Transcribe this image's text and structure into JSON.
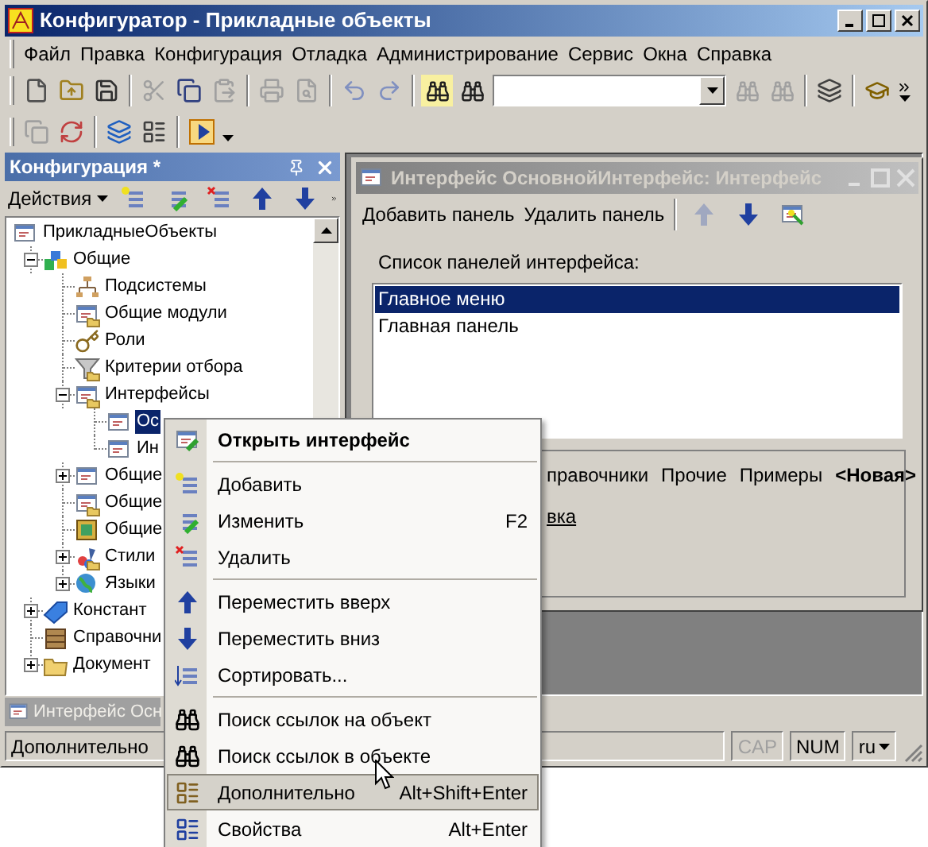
{
  "window": {
    "title": "Конфигуратор - Прикладные объекты"
  },
  "menu_bar": [
    "Файл",
    "Правка",
    "Конфигурация",
    "Отладка",
    "Администрирование",
    "Сервис",
    "Окна",
    "Справка"
  ],
  "config_panel": {
    "title": "Конфигурация *",
    "actions_label": "Действия",
    "tree": [
      {
        "label": "ПрикладныеОбъекты",
        "selected": false,
        "children": [
          {
            "label": "Общие",
            "selected": false,
            "expanded": true,
            "children": [
              {
                "label": "Подсистемы",
                "selected": false
              },
              {
                "label": "Общие модули",
                "selected": false
              },
              {
                "label": "Роли",
                "selected": false
              },
              {
                "label": "Критерии отбора",
                "selected": false
              },
              {
                "label": "Интерфейсы",
                "selected": false,
                "expanded": true,
                "children": [
                  {
                    "label": "Ос",
                    "selected": true
                  },
                  {
                    "label": "Ин",
                    "selected": false
                  }
                ]
              },
              {
                "label": "Общие",
                "selected": false,
                "expanded": false
              },
              {
                "label": "Общие",
                "selected": false
              },
              {
                "label": "Общие",
                "selected": false
              },
              {
                "label": "Стили",
                "selected": false,
                "expanded": false
              },
              {
                "label": "Языки",
                "selected": false,
                "expanded": false
              }
            ]
          },
          {
            "label": "Констант",
            "selected": false,
            "expanded": false
          },
          {
            "label": "Справочни",
            "selected": false
          },
          {
            "label": "Документ",
            "selected": false,
            "expanded": false
          }
        ]
      }
    ]
  },
  "child_window": {
    "title": "Интерфейс ОсновнойИнтерфейс: Интерфейс",
    "toolbar": [
      "Добавить панель",
      "Удалить панель"
    ],
    "list_label": "Список панелей интерфейса:",
    "panels": [
      {
        "label": "Главное меню",
        "selected": true
      },
      {
        "label": "Главная панель",
        "selected": false
      }
    ],
    "tabs": [
      {
        "label": "правочники",
        "emphasized": false
      },
      {
        "label": "Прочие",
        "emphasized": false
      },
      {
        "label": "Примеры",
        "emphasized": false
      },
      {
        "label": "<Новая>",
        "emphasized": true
      }
    ],
    "link": "вка"
  },
  "window_tabs": [
    {
      "label": "Интерфейс Осн"
    }
  ],
  "context_menu": [
    {
      "kind": "item",
      "label": "Открыть интерфейс",
      "default": true,
      "selected": false
    },
    {
      "kind": "separator"
    },
    {
      "kind": "item",
      "label": "Добавить",
      "default": false,
      "selected": false
    },
    {
      "kind": "item",
      "label": "Изменить",
      "shortcut": "F2",
      "default": false,
      "selected": false
    },
    {
      "kind": "item",
      "label": "Удалить",
      "default": false,
      "selected": false
    },
    {
      "kind": "separator"
    },
    {
      "kind": "item",
      "label": "Переместить вверх",
      "default": false,
      "selected": false
    },
    {
      "kind": "item",
      "label": "Переместить вниз",
      "default": false,
      "selected": false
    },
    {
      "kind": "item",
      "label": "Сортировать...",
      "default": false,
      "selected": false
    },
    {
      "kind": "separator"
    },
    {
      "kind": "item",
      "label": "Поиск ссылок на объект",
      "default": false,
      "selected": false
    },
    {
      "kind": "item",
      "label": "Поиск ссылок в объекте",
      "default": false,
      "selected": false
    },
    {
      "kind": "item",
      "label": "Дополнительно",
      "shortcut": "Alt+Shift+Enter",
      "default": false,
      "selected": true
    },
    {
      "kind": "item",
      "label": "Свойства",
      "shortcut": "Alt+Enter",
      "default": false,
      "selected": false
    }
  ],
  "status_bar": {
    "text": "Дополнительно",
    "indicators": [
      {
        "label": "CAP",
        "active": false
      },
      {
        "label": "NUM",
        "active": true
      }
    ],
    "language": "ru"
  }
}
